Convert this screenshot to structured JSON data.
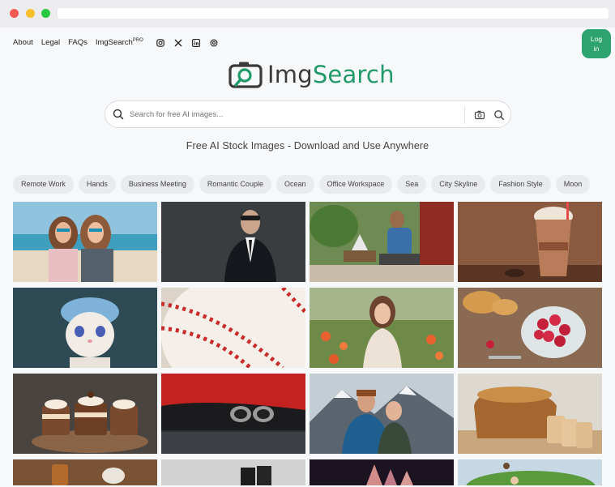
{
  "nav": {
    "about": "About",
    "legal": "Legal",
    "faqs": "FAQs",
    "imgsearch": "ImgSearch",
    "pro": "PRO"
  },
  "social_icons": [
    "instagram-icon",
    "x-icon",
    "linkedin-icon",
    "threads-icon"
  ],
  "login": {
    "line1": "Log",
    "line2": "in"
  },
  "logo": {
    "part1": "Img",
    "part2": "Search"
  },
  "search": {
    "placeholder": "Search for free AI images..."
  },
  "tagline": "Free AI Stock Images - Download and Use Anywhere",
  "categories": [
    "Remote Work",
    "Hands",
    "Business Meeting",
    "Romantic Couple",
    "Ocean",
    "Office Workspace",
    "Sea",
    "City Skyline",
    "Fashion Style",
    "Moon"
  ],
  "colors": {
    "brand": "#1f9a68",
    "login_bg": "#2fa36f"
  }
}
